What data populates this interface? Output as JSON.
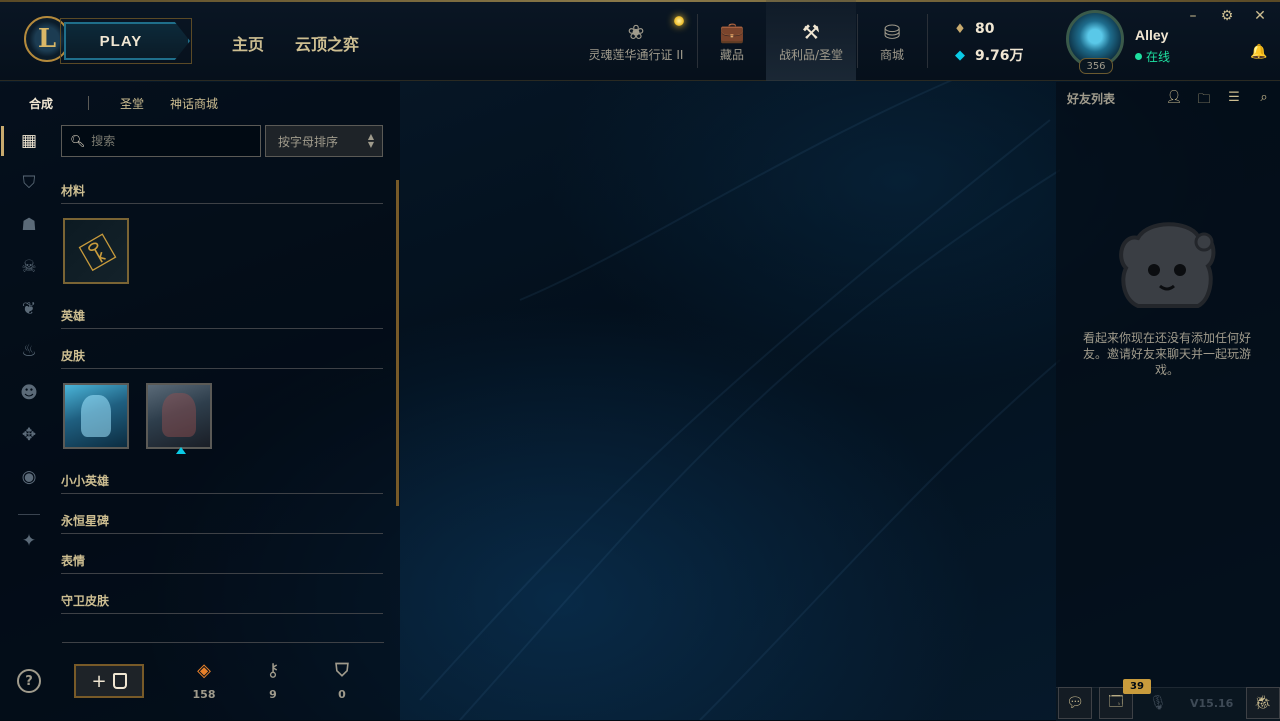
{
  "header": {
    "play_label": "PLAY",
    "nav_main": [
      "主页",
      "云顶之弈"
    ],
    "nav_items": [
      {
        "label": "灵魂莲华通行证 II",
        "icon": "lotus-icon"
      },
      {
        "label": "藏品",
        "icon": "collection-bag-icon"
      },
      {
        "label": "战利品/圣堂",
        "icon": "loot-hammer-icon",
        "active": true
      },
      {
        "label": "商城",
        "icon": "store-coins-icon"
      }
    ],
    "currencies": {
      "blue_essence": "80",
      "riot_points": "9.76万"
    },
    "user": {
      "name": "Alley",
      "status": "在线",
      "level": "356"
    },
    "colors": {
      "gold": "#c8aa6e",
      "online": "#1ee0a0",
      "accent_blue": "#0acbe6"
    }
  },
  "loot": {
    "tabs": [
      "合成",
      "圣堂",
      "神话商城"
    ],
    "search_placeholder": "搜索",
    "sort_label": "按字母排序",
    "sections": {
      "materials": "材料",
      "champions": "英雄",
      "skins": "皮肤",
      "little_legends": "小小英雄",
      "eternals": "永恒星碑",
      "emotes": "表情",
      "ward_skins": "守卫皮肤"
    },
    "counters": {
      "orange_essence": "158",
      "keys": "9",
      "chests": "0"
    },
    "help_label": "?"
  },
  "friends": {
    "title": "好友列表",
    "empty_message": "看起来你现在还没有添加任何好友。邀请好友来聊天并一起玩游戏。"
  },
  "footer": {
    "notifications_count": "39",
    "version": "V15.16"
  }
}
